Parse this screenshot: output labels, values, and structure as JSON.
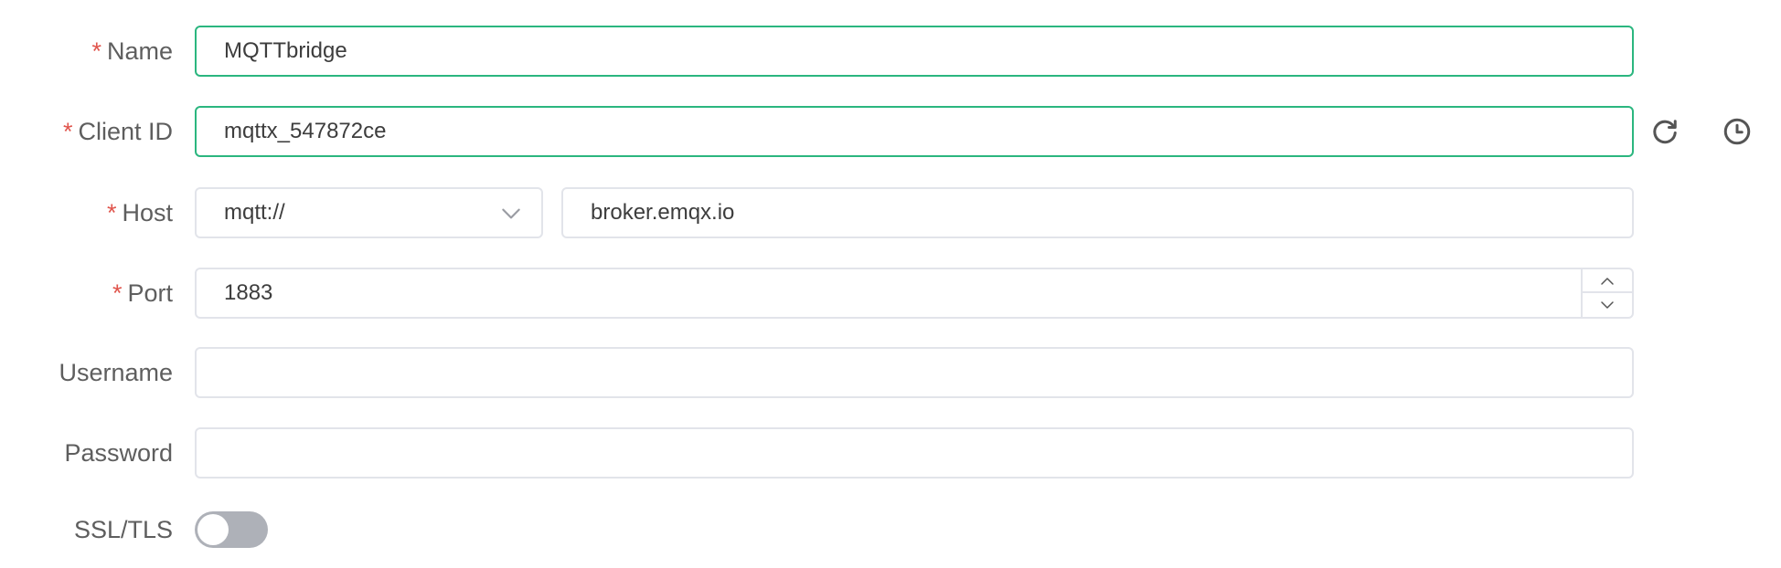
{
  "form": {
    "name": {
      "label": "Name",
      "required_mark": "*",
      "value": "MQTTbridge"
    },
    "client_id": {
      "label": "Client ID",
      "required_mark": "*",
      "value": "mqttx_547872ce",
      "refresh_icon": "refresh-icon",
      "history_icon": "clock-icon"
    },
    "host": {
      "label": "Host",
      "required_mark": "*",
      "protocol": "mqtt://",
      "address": "broker.emqx.io"
    },
    "port": {
      "label": "Port",
      "required_mark": "*",
      "value": "1883"
    },
    "username": {
      "label": "Username",
      "value": ""
    },
    "password": {
      "label": "Password",
      "value": ""
    },
    "ssl_tls": {
      "label": "SSL/TLS",
      "enabled": false
    }
  },
  "colors": {
    "focus_border": "#2bb67f",
    "required": "#e0554d",
    "label_text": "#5e5e5e",
    "toggle_off": "#aeb1b8"
  }
}
